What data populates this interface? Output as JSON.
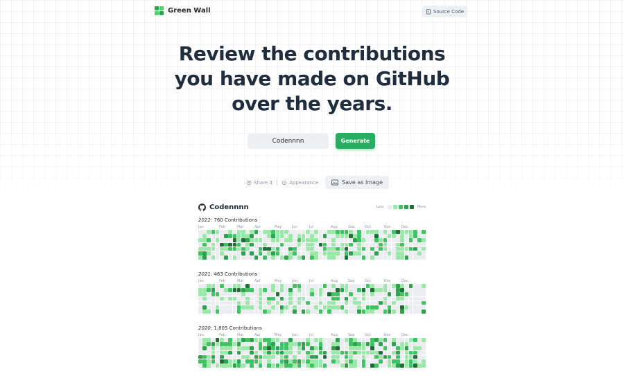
{
  "header": {
    "brand": "Green Wall",
    "source_button": "Source Code"
  },
  "hero": {
    "line1": "Review the contributions",
    "line2": "you have made on GitHub",
    "line3": "over the years."
  },
  "form": {
    "username_value": "Codennnn",
    "generate_label": "Generate"
  },
  "actions": {
    "share_label": "Share it",
    "appearance_label": "Appearance",
    "save_label": "Save as Image"
  },
  "card": {
    "username": "Codennnn",
    "legend_less": "Less",
    "legend_more": "More"
  },
  "colors": {
    "level0": "#ebedf0",
    "level1": "#9be9a8",
    "level2": "#40c463",
    "level3": "#30a14e",
    "level4": "#216e39",
    "accent": "#27ae60"
  },
  "months": [
    "Jan",
    "Feb",
    "Mar",
    "Apr",
    "May",
    "Jun",
    "Jul",
    "Aug",
    "Sep",
    "Oct",
    "Nov",
    "Dec"
  ],
  "years": [
    {
      "year": "2022",
      "summary": "760 Contributions",
      "intensity": 0.55
    },
    {
      "year": "2021",
      "summary": "463 Contributions",
      "intensity": 0.38
    },
    {
      "year": "2020",
      "summary": "1,805 Contributions",
      "intensity": 0.7
    }
  ]
}
